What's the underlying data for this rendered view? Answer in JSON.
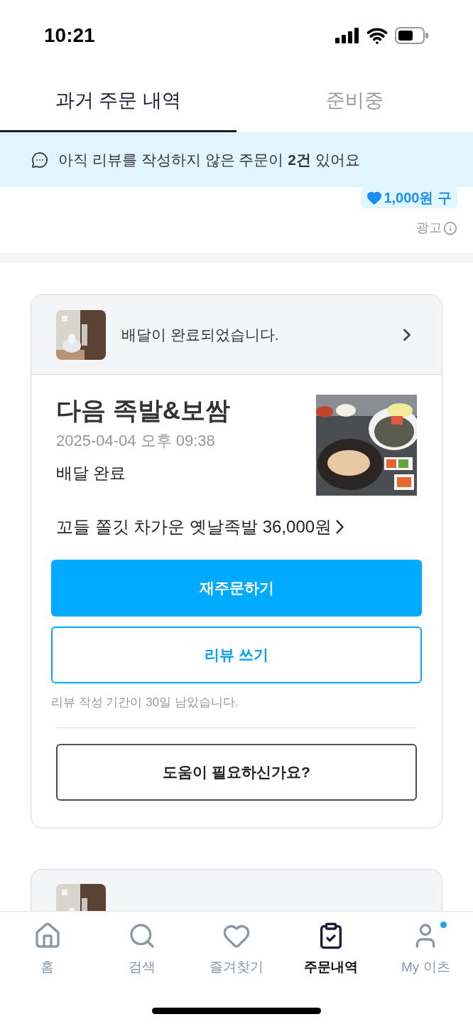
{
  "status_bar": {
    "time": "10:21"
  },
  "tabs": [
    {
      "label": "과거 주문 내역",
      "selected": true
    },
    {
      "label": "준비중",
      "selected": false
    }
  ],
  "notice": {
    "text": "아직 리뷰를 작성하지 않은 주문이 **2건** 있어요"
  },
  "ad": {
    "coupon": "1,000원 구",
    "label": "광고"
  },
  "orders": [
    {
      "kind": "full",
      "status_message": "배달이 완료되었습니다.",
      "store": "다음 족발&보쌈",
      "datetime": "2025-04-04 오후 09:38",
      "state": "배달 완료",
      "items": "꼬들 쫄깃 차가운 옛날족발 36,000원",
      "reorder": "재주문하기",
      "review": "리뷰 쓰기",
      "review_note": "리뷰 작성 기간이 30일 남았습니다.",
      "help": "도움이 필요하신가요?"
    },
    {
      "kind": "partial"
    }
  ],
  "nav": [
    {
      "label": "홈",
      "kind": "home",
      "selected": false,
      "dot": false
    },
    {
      "label": "검색",
      "kind": "search",
      "selected": false,
      "dot": false
    },
    {
      "label": "즐겨찾기",
      "kind": "heart",
      "selected": false,
      "dot": false
    },
    {
      "label": "주문내역",
      "kind": "orders",
      "selected": true,
      "dot": false
    },
    {
      "label": "My 이츠",
      "kind": "user",
      "selected": false,
      "dot": true
    }
  ]
}
